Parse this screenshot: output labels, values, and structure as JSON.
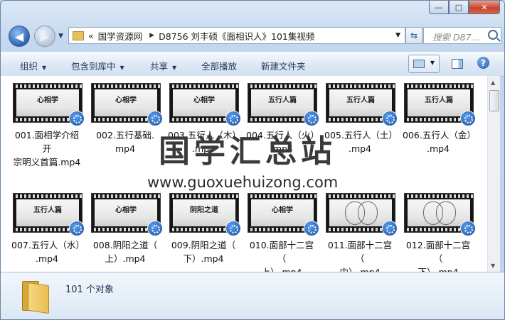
{
  "window": {
    "caption_buttons": {
      "minimize": "—",
      "maximize": "□",
      "close": "✕"
    }
  },
  "nav": {
    "back_icon": "◀",
    "forward_icon": "▶",
    "history_dropdown": "▼",
    "address": {
      "prefix": "«",
      "crumbs": [
        "国学资源网",
        "D8756 刘丰硕《面相识人》101集视频"
      ],
      "separator": "▶",
      "dropdown": "▼"
    },
    "refresh_icon": "⇆",
    "search_placeholder": "搜索 D87..."
  },
  "toolbar": {
    "organize": "组织",
    "include_library": "包含到库中",
    "share": "共享",
    "play_all": "全部播放",
    "new_folder": "新建文件夹",
    "dropdown_glyph": "▼",
    "help": "?"
  },
  "files": [
    {
      "name": "001.面相学介绍开宗明义首篇.mp4",
      "slide": "心相学"
    },
    {
      "name": "002.五行基础.mp4",
      "slide": "心相学"
    },
    {
      "name": "003.五行人（木）.mp4",
      "slide": "心相学"
    },
    {
      "name": "004.五行人（火）.mp4",
      "slide": "五行人篇"
    },
    {
      "name": "005.五行人（土）.mp4",
      "slide": "五行人篇"
    },
    {
      "name": "006.五行人（金）.mp4",
      "slide": "五行人篇"
    },
    {
      "name": "007.五行人（水）.mp4",
      "slide": "五行人篇"
    },
    {
      "name": "008.阴阳之道（上）.mp4",
      "slide": "心相学"
    },
    {
      "name": "009.阴阳之道（下）.mp4",
      "slide": "阴阳之道"
    },
    {
      "name": "010.面部十二宫（上）.mp4",
      "slide": "心相学"
    },
    {
      "name": "011.面部十二宫（中）.mp4",
      "slide": ""
    },
    {
      "name": "012.面部十二宫（下）.mp4",
      "slide": ""
    }
  ],
  "file_lines": [
    [
      "001.面相学介绍开",
      "宗明义首篇.mp4"
    ],
    [
      "002.五行基础.",
      "mp4"
    ],
    [
      "003.五行人（木）",
      ".mp4"
    ],
    [
      "004.五行人（火）",
      ".mp4"
    ],
    [
      "005.五行人（土）",
      ".mp4"
    ],
    [
      "006.五行人（金）",
      ".mp4"
    ],
    [
      "007.五行人（水）",
      ".mp4"
    ],
    [
      "008.阴阳之道（",
      "上）.mp4"
    ],
    [
      "009.阴阳之道（",
      "下）.mp4"
    ],
    [
      "010.面部十二宫（",
      "上）.mp4"
    ],
    [
      "011.面部十二宫（",
      "中）.mp4"
    ],
    [
      "012.面部十二宫（",
      "下）.mp4"
    ]
  ],
  "watermark": {
    "cn": "国学汇总站",
    "url": "www.guoxuehuizong.com"
  },
  "details": {
    "count": "101 个对象"
  },
  "scrollbar": {
    "up": "▲",
    "down": "▼"
  }
}
